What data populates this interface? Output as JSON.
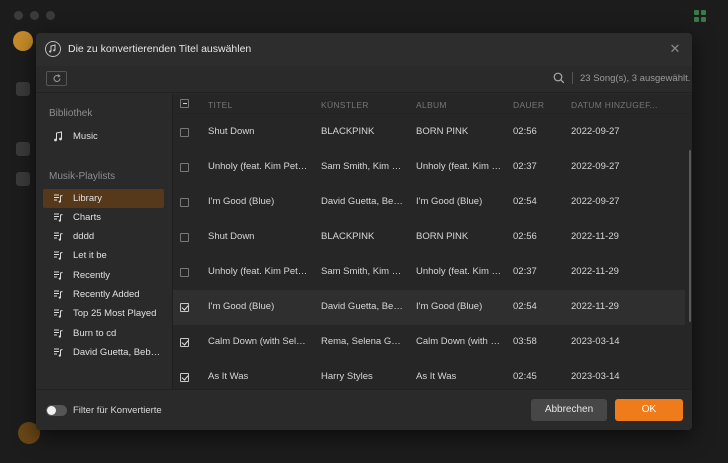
{
  "dialog": {
    "title": "Die zu konvertierenden Titel auswählen",
    "song_count": "23 Song(s), 3 ausgewählt."
  },
  "sidebar": {
    "library_heading": "Bibliothek",
    "library_items": [
      {
        "label": "Music",
        "icon": "music-note-icon"
      }
    ],
    "playlists_heading": "Musik-Playlists",
    "playlists": [
      {
        "label": "Library",
        "active": true
      },
      {
        "label": "Charts"
      },
      {
        "label": "dddd"
      },
      {
        "label": "Let it be"
      },
      {
        "label": "Recently"
      },
      {
        "label": "Recently Added"
      },
      {
        "label": "Top 25 Most Played"
      },
      {
        "label": "Burn to cd"
      },
      {
        "label": "David Guetta, Bebe R..."
      }
    ]
  },
  "table": {
    "headers": {
      "title": "TITEL",
      "artist": "KÜNSTLER",
      "album": "ALBUM",
      "duration": "DAUER",
      "date": "DATUM HINZUGEF..."
    },
    "rows": [
      {
        "checked": false,
        "title": "Shut Down",
        "artist": "BLACKPINK",
        "album": "BORN PINK",
        "duration": "02:56",
        "date": "2022-09-27"
      },
      {
        "checked": false,
        "title": "Unholy (feat. Kim Petra...",
        "artist": "Sam Smith, Kim Pe...",
        "album": "Unholy (feat. Kim P...",
        "duration": "02:37",
        "date": "2022-09-27"
      },
      {
        "checked": false,
        "title": "I'm Good (Blue)",
        "artist": "David Guetta, Beb...",
        "album": "I'm Good (Blue)",
        "duration": "02:54",
        "date": "2022-09-27"
      },
      {
        "checked": false,
        "title": "Shut Down",
        "artist": "BLACKPINK",
        "album": "BORN PINK",
        "duration": "02:56",
        "date": "2022-11-29"
      },
      {
        "checked": false,
        "title": "Unholy (feat. Kim Petra...",
        "artist": "Sam Smith, Kim Pe...",
        "album": "Unholy (feat. Kim P...",
        "duration": "02:37",
        "date": "2022-11-29"
      },
      {
        "checked": true,
        "highlight": true,
        "title": "I'm Good (Blue)",
        "artist": "David Guetta, Beb...",
        "album": "I'm Good (Blue)",
        "duration": "02:54",
        "date": "2022-11-29"
      },
      {
        "checked": true,
        "title": "Calm Down (with Sele...",
        "artist": "Rema, Selena Gom...",
        "album": "Calm Down (with S...",
        "duration": "03:58",
        "date": "2023-03-14"
      },
      {
        "checked": true,
        "title": "As It Was",
        "artist": "Harry Styles",
        "album": "As It Was",
        "duration": "02:45",
        "date": "2023-03-14"
      }
    ]
  },
  "footer": {
    "filter_label": "Filter für Konvertierte",
    "cancel_label": "Abbrechen",
    "ok_label": "OK"
  },
  "colors": {
    "accent": "#ef7b1b",
    "active_item": "#56381a"
  }
}
